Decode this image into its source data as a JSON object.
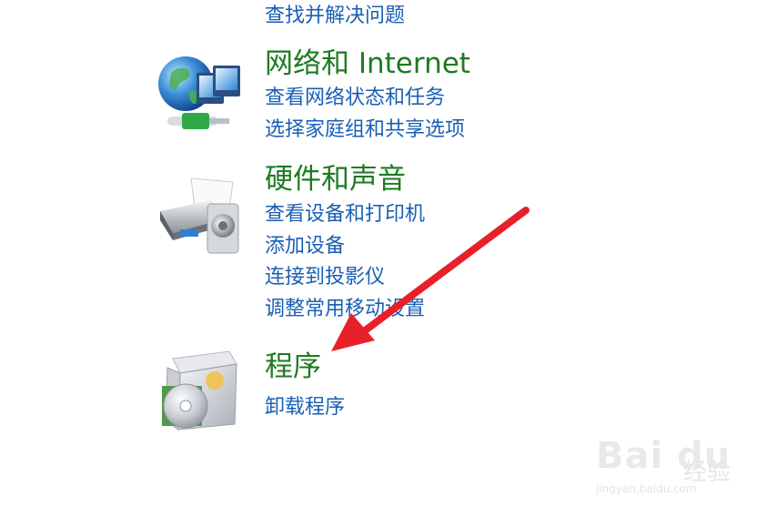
{
  "troubleshoot": {
    "link": "查找并解决问题"
  },
  "network": {
    "icon": "globe-network-icon",
    "title": "网络和 Internet",
    "links": [
      "查看网络状态和任务",
      "选择家庭组和共享选项"
    ]
  },
  "hardware": {
    "icon": "printer-speaker-icon",
    "title": "硬件和声音",
    "links": [
      "查看设备和打印机",
      "添加设备",
      "连接到投影仪",
      "调整常用移动设置"
    ]
  },
  "programs": {
    "icon": "software-box-cd-icon",
    "title": "程序",
    "links": [
      "卸载程序"
    ]
  },
  "annotation": {
    "arrow_color": "#e8202a"
  },
  "watermark": {
    "logo": "Bai du",
    "text": "经验",
    "url": "jingyan.baidu.com"
  },
  "colors": {
    "title": "#1e7a22",
    "link": "#1a5fb4"
  }
}
